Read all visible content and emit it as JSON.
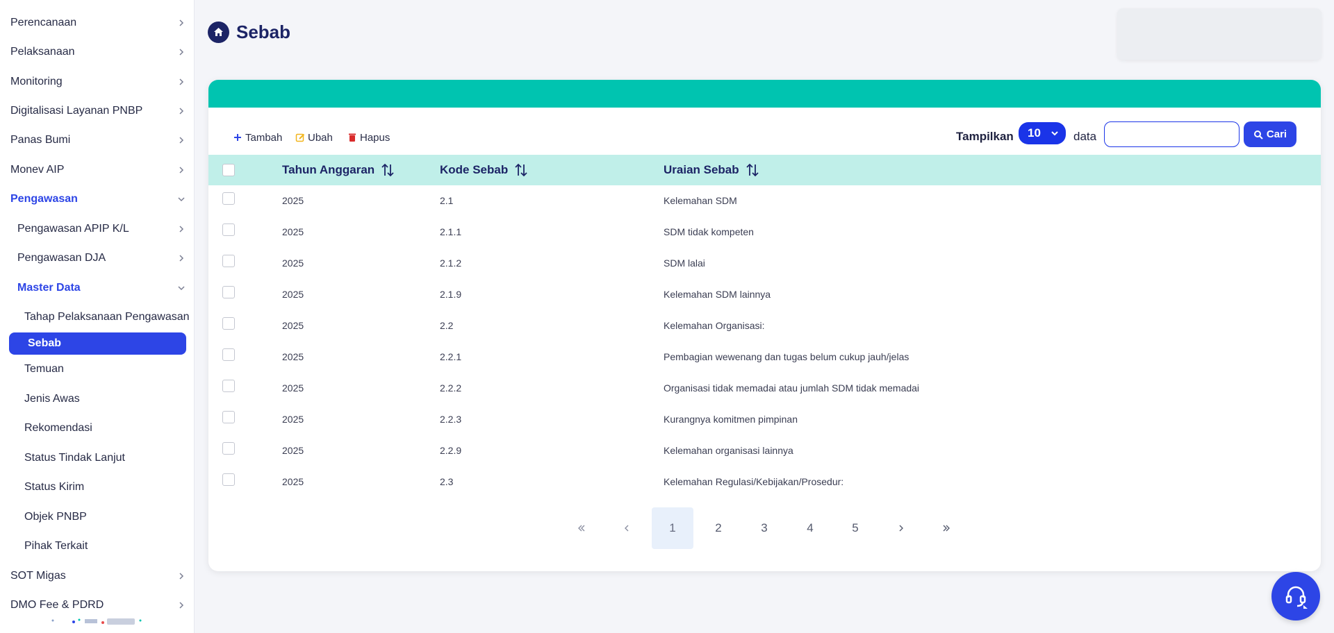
{
  "sidebar": {
    "items": [
      {
        "label": "Perencanaan"
      },
      {
        "label": "Pelaksanaan"
      },
      {
        "label": "Monitoring"
      },
      {
        "label": "Digitalisasi Layanan PNBP"
      },
      {
        "label": "Panas Bumi"
      },
      {
        "label": "Monev AIP"
      },
      {
        "label": "Pengawasan"
      },
      {
        "label": "Pengawasan APIP K/L"
      },
      {
        "label": "Pengawasan DJA"
      },
      {
        "label": "Master Data"
      },
      {
        "label": "Tahap Pelaksanaan Pengawasan"
      },
      {
        "label": "Sebab"
      },
      {
        "label": "Temuan"
      },
      {
        "label": "Jenis Awas"
      },
      {
        "label": "Rekomendasi"
      },
      {
        "label": "Status Tindak Lanjut"
      },
      {
        "label": "Status Kirim"
      },
      {
        "label": "Objek PNBP"
      },
      {
        "label": "Pihak Terkait"
      },
      {
        "label": "SOT Migas"
      },
      {
        "label": "DMO Fee & PDRD"
      }
    ]
  },
  "header": {
    "title": "Sebab",
    "icon": "home-icon"
  },
  "toolbar": {
    "add_label": "Tambah",
    "edit_label": "Ubah",
    "delete_label": "Hapus",
    "show_label": "Tampilkan",
    "page_size": "10",
    "data_label": "data",
    "search_value": "",
    "search_placeholder": "",
    "search_button": "Cari"
  },
  "table": {
    "columns": [
      "Tahun Anggaran",
      "Kode Sebab",
      "Uraian Sebab"
    ],
    "rows": [
      {
        "tahun": "2025",
        "kode": "2.1",
        "uraian": "Kelemahan SDM"
      },
      {
        "tahun": "2025",
        "kode": "2.1.1",
        "uraian": "SDM tidak kompeten"
      },
      {
        "tahun": "2025",
        "kode": "2.1.2",
        "uraian": "SDM lalai"
      },
      {
        "tahun": "2025",
        "kode": "2.1.9",
        "uraian": "Kelemahan SDM lainnya"
      },
      {
        "tahun": "2025",
        "kode": "2.2",
        "uraian": "Kelemahan Organisasi:"
      },
      {
        "tahun": "2025",
        "kode": "2.2.1",
        "uraian": "Pembagian wewenang dan tugas belum cukup jauh/jelas"
      },
      {
        "tahun": "2025",
        "kode": "2.2.2",
        "uraian": "Organisasi tidak memadai atau jumlah SDM tidak memadai"
      },
      {
        "tahun": "2025",
        "kode": "2.2.3",
        "uraian": "Kurangnya komitmen pimpinan"
      },
      {
        "tahun": "2025",
        "kode": "2.2.9",
        "uraian": "Kelemahan organisasi lainnya"
      },
      {
        "tahun": "2025",
        "kode": "2.3",
        "uraian": "Kelemahan Regulasi/Kebijakan/Prosedur:"
      }
    ]
  },
  "pagination": {
    "current": "1",
    "pages": [
      "1",
      "2",
      "3",
      "4",
      "5"
    ]
  },
  "colors": {
    "primary": "#2d45e6",
    "teal": "#00c4b0",
    "table_header": "#c0efe9",
    "title": "#1c2466"
  }
}
